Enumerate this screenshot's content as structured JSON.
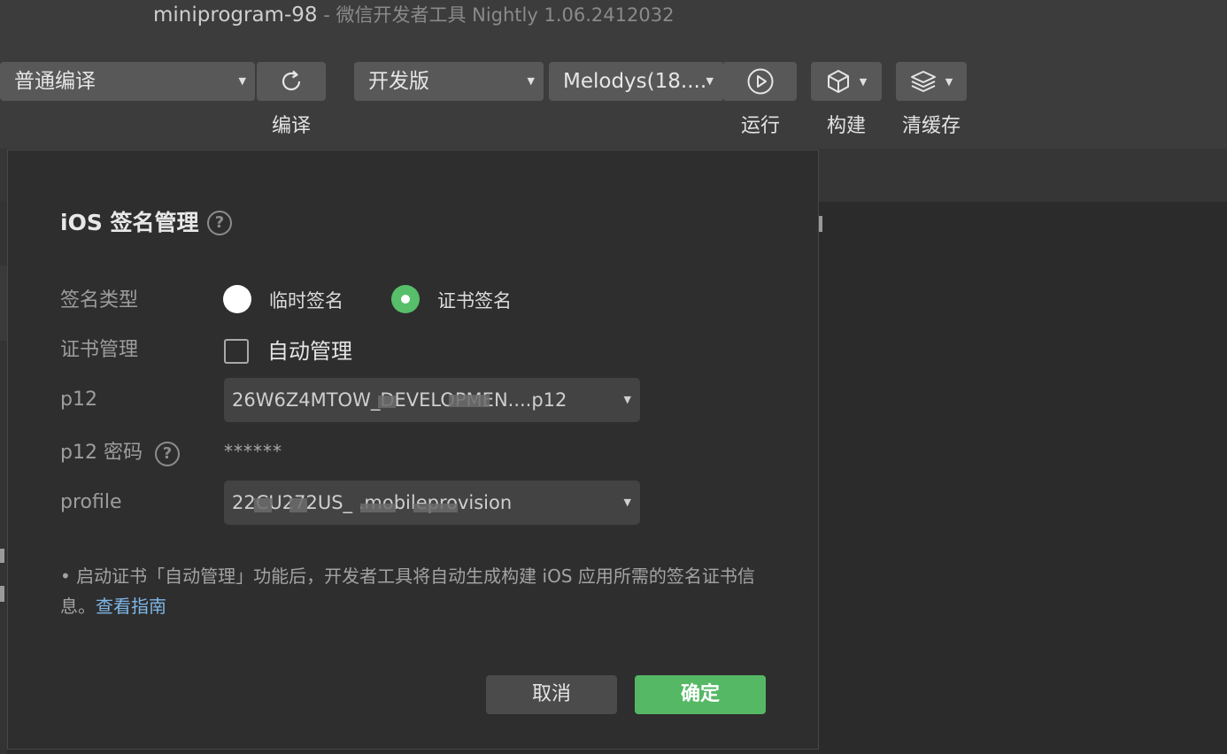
{
  "window": {
    "project": "miniprogram-98",
    "title_rest": " - 微信开发者工具 Nightly 1.06.2412032"
  },
  "toolbar": {
    "compile_mode": "普通编译",
    "compile_label": "编译",
    "version_select": "开发版",
    "device_select": "Melodys(18....",
    "run_label": "运行",
    "build_label": "构建",
    "clear_cache_label": "清缓存"
  },
  "dialog": {
    "title": "iOS 签名管理",
    "help_glyph": "?",
    "sign_type_label": "签名类型",
    "sign_type_options": [
      "临时签名",
      "证书签名"
    ],
    "sign_type_selected": "证书签名",
    "cert_manage_label": "证书管理",
    "auto_manage_label": "自动管理",
    "auto_manage_checked": false,
    "p12_label": "p12",
    "p12_value": "26W6Z4MTOW_DEVELOPMEN....p12",
    "p12_password_label": "p12 密码",
    "p12_password_value": "******",
    "profile_label": "profile",
    "profile_value": "22CU272US_ .mobileprovision",
    "note_text": "• 启动证书「自动管理」功能后，开发者工具将自动生成构建 iOS 应用所需的签名证书信息。",
    "note_link": "查看指南",
    "cancel_label": "取消",
    "ok_label": "确定"
  },
  "colors": {
    "accent_green": "#57be6a",
    "link_blue": "#7eb6e6",
    "dialog_bg": "#2e2e2e"
  }
}
